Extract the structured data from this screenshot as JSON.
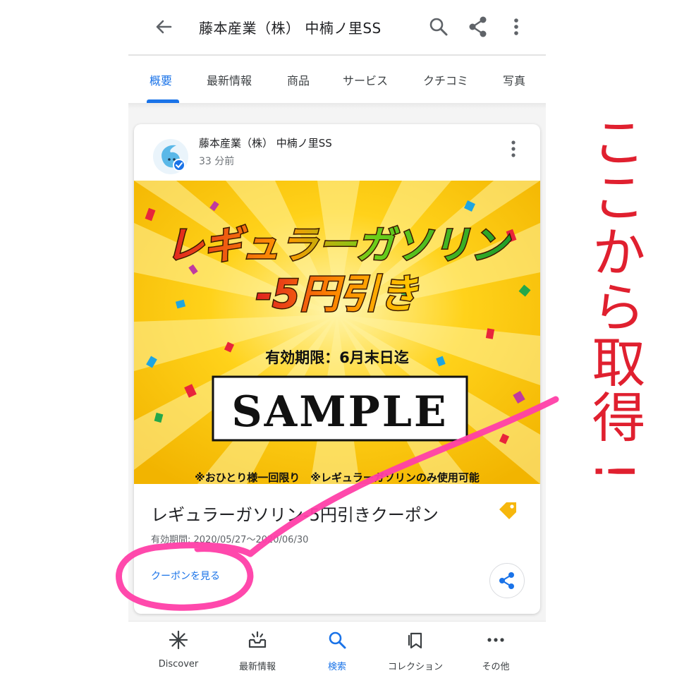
{
  "app_bar": {
    "title": "藤本産業（株） 中楠ノ里SS",
    "back_icon": "arrow-left-icon",
    "search_icon": "search-icon",
    "share_icon": "share-icon",
    "more_icon": "more-vertical-icon"
  },
  "tabs": [
    {
      "label": "概要",
      "active": true
    },
    {
      "label": "最新情報",
      "active": false
    },
    {
      "label": "商品",
      "active": false
    },
    {
      "label": "サービス",
      "active": false
    },
    {
      "label": "クチコミ",
      "active": false
    },
    {
      "label": "写真",
      "active": false
    }
  ],
  "post": {
    "author": "藤本産業（株） 中楠ノ里SS",
    "time": "33 分前",
    "banner": {
      "headline_line1": "レギュラーガソリン",
      "headline_line2": "-5円引き",
      "validity": "有効期限：6月末日迄",
      "sample_stamp": "SAMPLE",
      "notes": "※おひとり様一回限り　※レギュラーガソリンのみ使用可能"
    },
    "coupon_title": "レギュラーガソリン-5円引きクーポン",
    "coupon_validity": "有効期間: 2020/05/27〜2020/06/30",
    "view_coupon_label": "クーポンを見る"
  },
  "bottom_nav": [
    {
      "label": "Discover",
      "icon": "asterisk-icon",
      "active": false
    },
    {
      "label": "最新情報",
      "icon": "updates-icon",
      "active": false
    },
    {
      "label": "検索",
      "icon": "search-icon",
      "active": true
    },
    {
      "label": "コレクション",
      "icon": "bookmark-icon",
      "active": false
    },
    {
      "label": "その他",
      "icon": "more-horizontal-icon",
      "active": false
    }
  ],
  "annotation": {
    "text": "ここから取得!",
    "color": "#e0202f",
    "scribble_color": "#ff3fa8"
  },
  "colors": {
    "accent": "#1a73e8",
    "banner_yellow": "#ffcc00"
  }
}
